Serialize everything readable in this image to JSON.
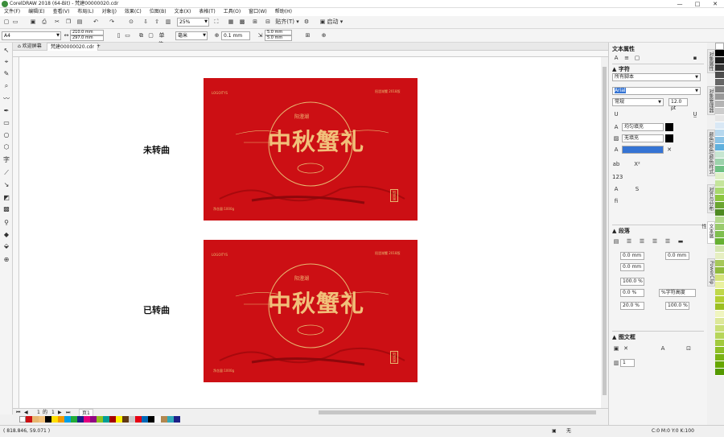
{
  "window": {
    "title": "CorelDRAW 2018 (64-Bit) - 梵建00000020.cdr"
  },
  "menu": [
    "文件(F)",
    "编辑(E)",
    "查看(V)",
    "布局(L)",
    "对象(J)",
    "效果(C)",
    "位图(B)",
    "文本(X)",
    "表格(T)",
    "工具(O)",
    "窗口(W)",
    "帮助(H)"
  ],
  "toolbar": {
    "zoom": "25%",
    "snap": "贴齐(T)",
    "launch": "启动"
  },
  "propbar": {
    "page_size": "A4",
    "width": "210.0 mm",
    "height": "297.0 mm",
    "units_label": "单位:",
    "units": "毫米",
    "nudge": "0.1 mm",
    "dup_x": "5.0 mm",
    "dup_y": "5.0 mm"
  },
  "tabs": {
    "welcome": "欢迎屏幕",
    "doc": "梵建00000020.cdr"
  },
  "canvas": {
    "label_top": "未转曲",
    "label_bottom": "已转曲",
    "art": {
      "logo": "LOGOITYS",
      "title": "中秋蟹礼",
      "badge": "阳澄湖",
      "corner": "阳澄湖蟹 2018版",
      "seal": "阳澄湖",
      "spec": "净含量:1000g"
    }
  },
  "pager": {
    "current": "1",
    "of": "的",
    "total": "1",
    "page_tab": "页1"
  },
  "status": {
    "coords": "( 818.846, 59.071 )",
    "fill_none": "无",
    "color_info": "C:0 M:0 Y:0 K:100"
  },
  "docker": {
    "title": "文本属性",
    "section_char": "字符",
    "script": "所有脚本",
    "font": "Arial",
    "style": "常规",
    "size": "12.0 pt",
    "fill_type": "均匀填充",
    "bg_fill": "无填充",
    "section_para": "段落",
    "indent_left": "0.0 mm",
    "indent_right": "0.0 mm",
    "indent_first": "0.0 mm",
    "line_spacing": "100.0 %",
    "spacing_unit": "%字符高度",
    "before_para": "0.0 %",
    "char_spacing": "20.0 %",
    "word_spacing": "100.0 %",
    "section_frame": "图文框",
    "columns": "1"
  },
  "side_tabs": [
    "对象属性",
    "对象管理器",
    "颜色/颜色/颜色样式",
    "对齐与分布",
    "文本属性",
    "PowerClip"
  ],
  "colors": {
    "art_red": "#cc0f14",
    "gold": "#f1c07a"
  }
}
